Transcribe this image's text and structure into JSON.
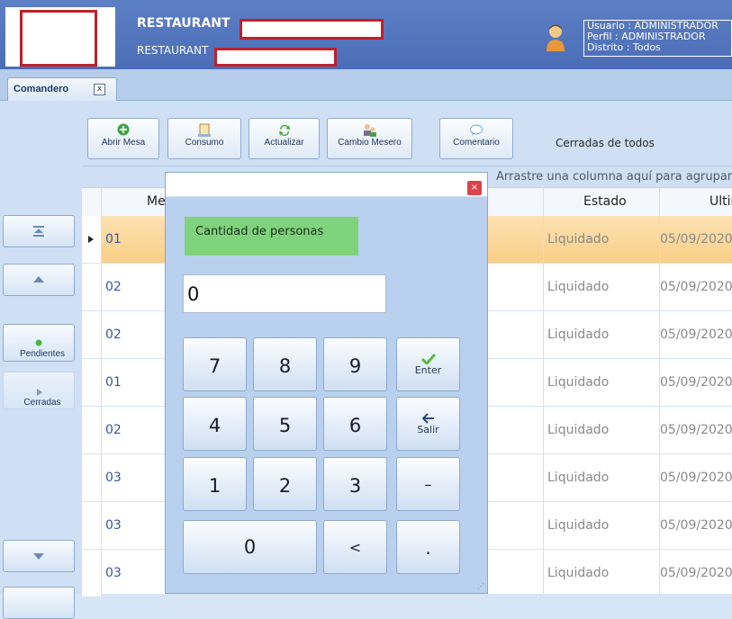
{
  "header": {
    "title": "RESTAURANT",
    "subtitle": "RESTAURANT",
    "user_lines": [
      "Usuario : ADMINISTRADOR",
      "Perfil : ADMINISTRADOR",
      "Distrito : Todos"
    ]
  },
  "tabs": [
    {
      "label": "Comandero",
      "close_symbol": "x"
    }
  ],
  "toolbar": {
    "abrir_mesa": "Abrir Mesa",
    "consumo": "Consumo",
    "actualizar": "Actualizar",
    "cambio_mesero": "Cambio Mesero",
    "comentario": "Comentario",
    "filter_text": "Cerradas de todos"
  },
  "sidebar": {
    "pendientes": "Pendientes",
    "cerradas": "Cerradas"
  },
  "grid": {
    "group_hint": "Arrastre una columna aquí para agrupar",
    "columns": [
      "Mesa",
      "Estado",
      "Ultimo"
    ],
    "rows": [
      {
        "mesa": "01",
        "estado": "Liquidado",
        "ultimo": "05/09/2020"
      },
      {
        "mesa": "02",
        "estado": "Liquidado",
        "ultimo": "05/09/2020"
      },
      {
        "mesa": "02",
        "estado": "Liquidado",
        "ultimo": "05/09/2020"
      },
      {
        "mesa": "01",
        "estado": "Liquidado",
        "ultimo": "05/09/2020"
      },
      {
        "mesa": "02",
        "estado": "Liquidado",
        "ultimo": "05/09/2020"
      },
      {
        "mesa": "03",
        "estado": "Liquidado",
        "ultimo": "05/09/2020"
      },
      {
        "mesa": "03",
        "estado": "Liquidado",
        "ultimo": "05/09/2020"
      },
      {
        "mesa": "03",
        "estado": "Liquidado",
        "ultimo": "05/09/2020"
      }
    ]
  },
  "dialog": {
    "prompt": "Cantidad de personas",
    "value": "0",
    "close_symbol": "×",
    "keys": {
      "k7": "7",
      "k8": "8",
      "k9": "9",
      "k4": "4",
      "k5": "5",
      "k6": "6",
      "k1": "1",
      "k2": "2",
      "k3": "3",
      "k0": "0",
      "back": "<",
      "dot": ".",
      "minus": "–",
      "enter": "Enter",
      "salir": "Salir"
    }
  },
  "colors": {
    "header_bg": "#4b6db7",
    "selected_row": "#f9cf86",
    "prompt_bg": "#7fd37c",
    "accent_red": "#c0202a"
  }
}
